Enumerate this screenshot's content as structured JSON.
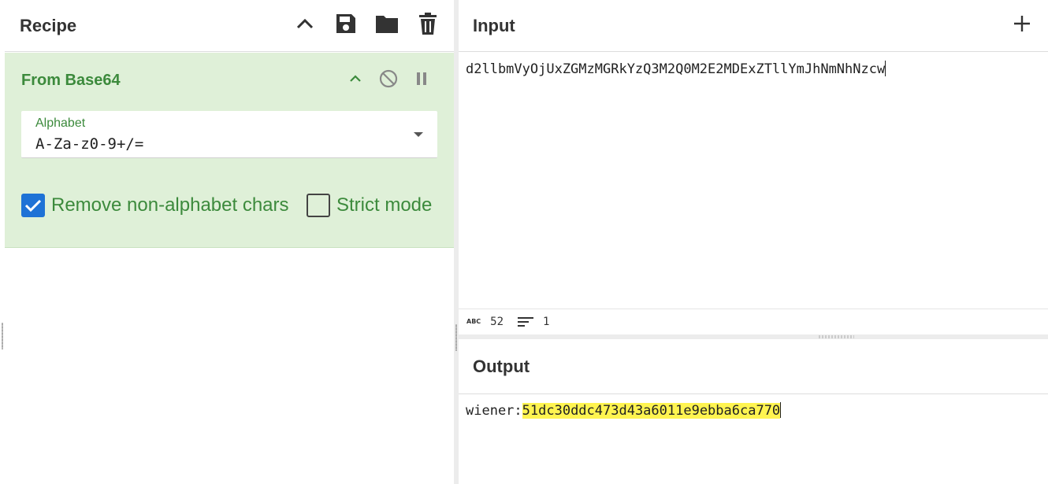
{
  "recipe": {
    "title": "Recipe",
    "operation": {
      "name": "From Base64",
      "alphabet_label": "Alphabet",
      "alphabet_value": "A-Za-z0-9+/=",
      "remove_non_alphabet_label": "Remove non-alphabet chars",
      "remove_non_alphabet_checked": true,
      "strict_mode_label": "Strict mode",
      "strict_mode_checked": false
    }
  },
  "input": {
    "title": "Input",
    "text": "d2llbmVyOjUxZGMzMGRkYzQ3M2Q0M2E2MDExZTllYmJhNmNhNzcw",
    "status_length": "52",
    "status_lines": "1"
  },
  "output": {
    "title": "Output",
    "prefix": "wiener:",
    "highlighted": "51dc30ddc473d43a6011e9ebba6ca770"
  },
  "colors": {
    "op_background": "#dff0d8",
    "op_text": "#3c8a3c",
    "checkbox_checked": "#1e72d6",
    "highlight": "#fff450"
  }
}
